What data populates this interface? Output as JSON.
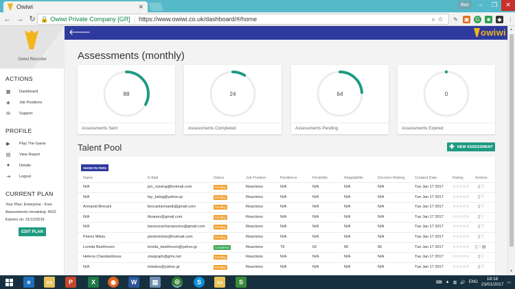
{
  "browser": {
    "tab_title": "Owiwi",
    "tab_close": "✕",
    "user_name": "Bas",
    "secure_label": "Owiwi Private Company [GR]",
    "url": "https://www.owiwi.co.uk/dashboard/#/home"
  },
  "app": {
    "brand": "owiwi",
    "role": "Owiwi Recruiter"
  },
  "sidebar": {
    "actions_heading": "ACTIONS",
    "actions": [
      {
        "label": "Dashboard",
        "icon": "dashboard-icon"
      },
      {
        "label": "Job Positions",
        "icon": "layers-icon"
      },
      {
        "label": "Support",
        "icon": "mail-icon"
      }
    ],
    "profile_heading": "PROFILE",
    "profile": [
      {
        "label": "Play The Game",
        "icon": "play-icon"
      },
      {
        "label": "View Report",
        "icon": "report-icon"
      },
      {
        "label": "Details",
        "icon": "person-icon"
      },
      {
        "label": "Logout",
        "icon": "logout-icon"
      }
    ],
    "plan_heading": "CURRENT PLAN",
    "plan_lines": [
      "Your Plan: Enterprise - Free",
      "Assessments remaining: 4532",
      "Expires on: 31/12/2019"
    ],
    "edit_plan": "EDIT PLAN"
  },
  "assessments": {
    "title": "Assessments (monthly)",
    "cards": [
      {
        "value": "88",
        "label": "Assessments Sent",
        "fraction": 0.33
      },
      {
        "value": "24",
        "label": "Assessments Completed",
        "fraction": 0.09
      },
      {
        "value": "64",
        "label": "Assessments Pending",
        "fraction": 0.24
      },
      {
        "value": "0",
        "label": "Assessments Expired",
        "fraction": 0.0
      }
    ]
  },
  "talent_pool": {
    "title": "Talent Pool",
    "new_button": "NEW ASSESSMENT",
    "show_filters": "SHOW FILTERS",
    "columns": [
      "Name",
      "E-Mail",
      "Status",
      "Job Position",
      "Resilience",
      "Flexibility",
      "Adaptability",
      "Decision Making",
      "Created Date",
      "Rating",
      "Actions"
    ],
    "rows": [
      [
        "N/A",
        "jon_rossing@hotmail.com",
        "Pending",
        "Reactions",
        "N/A",
        "N/A",
        "N/A",
        "N/A",
        "Tue Jan 17 2017"
      ],
      [
        "N/A",
        "fay_kalog@yahoo.gr",
        "Pending",
        "Reactions",
        "N/A",
        "N/A",
        "N/A",
        "N/A",
        "Tue Jan 17 2017"
      ],
      [
        "Armandi Brecani",
        "brecaniarmandi@gmail.com",
        "Pending",
        "Reactions",
        "N/A",
        "N/A",
        "N/A",
        "N/A",
        "Tue Jan 17 2017"
      ],
      [
        "N/A",
        "tlivanou@gmail.com",
        "Pending",
        "Reactions",
        "N/A",
        "N/A",
        "N/A",
        "N/A",
        "Tue Jan 17 2017"
      ],
      [
        "N/A",
        "tassoszacharopoulos@gmail.com",
        "Pending",
        "Reactions",
        "N/A",
        "N/A",
        "N/A",
        "N/A",
        "Tue Jan 17 2017"
      ],
      [
        "Petros Mitsis",
        "piedromitsis@hotmail.com",
        "Pending",
        "Reactions",
        "N/A",
        "N/A",
        "N/A",
        "N/A",
        "Tue Jan 17 2017"
      ],
      [
        "Loretta Beethoven",
        "loretta_beethoven@yahoo.gr",
        "Completed",
        "Reactions",
        "79",
        "62",
        "60",
        "66",
        "Tue Jan 17 2017"
      ],
      [
        "Helena Charalambous",
        "zoegraph@gmx.net",
        "Pending",
        "Reactions",
        "N/A",
        "N/A",
        "N/A",
        "N/A",
        "Tue Jan 17 2017"
      ],
      [
        "N/A",
        "iridakos@yahoo.gr",
        "Pending",
        "Reactions",
        "N/A",
        "N/A",
        "N/A",
        "N/A",
        "Tue Jan 17 2017"
      ]
    ],
    "rating_glyphs": "☆☆☆☆☆",
    "colors": {
      "pending": "#f0a030",
      "completed": "#3aa655"
    }
  },
  "colors": {
    "accent": "#1e9a82",
    "header": "#2e3a9e",
    "brand": "#f2b51c",
    "ring_track": "#ececec"
  },
  "taskbar": {
    "language": "ENG",
    "time": "18:18",
    "date": "23/01/2017"
  }
}
